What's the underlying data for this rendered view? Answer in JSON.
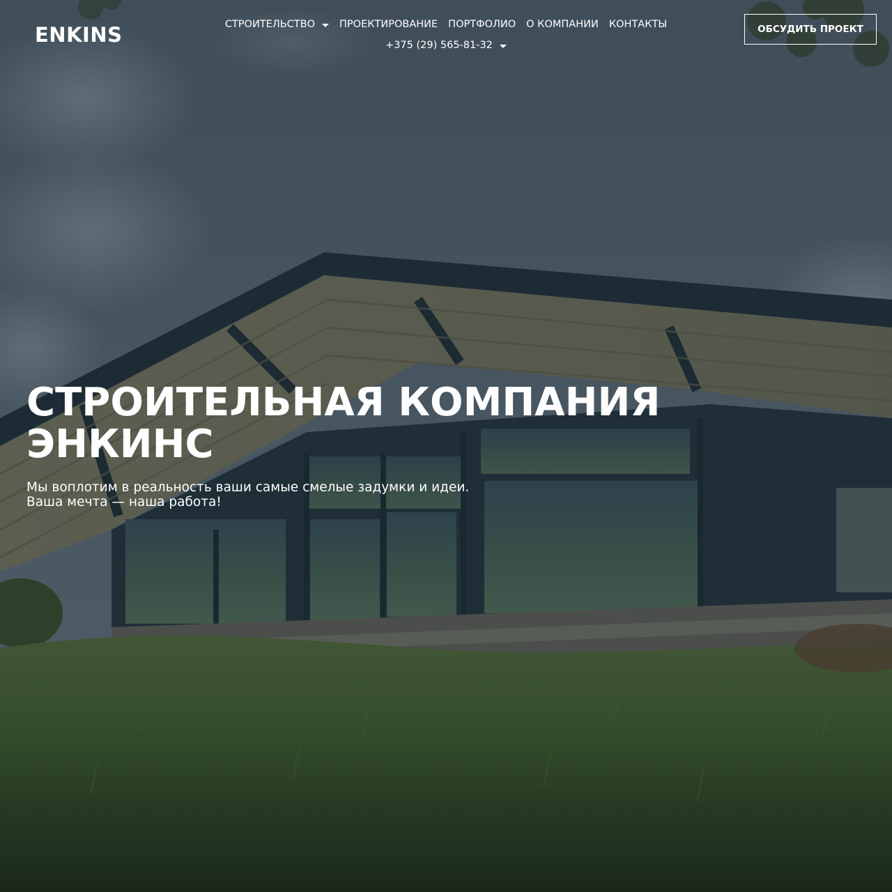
{
  "header": {
    "logo_text": "ENKINS",
    "nav_items": [
      {
        "label": "СТРОИТЕЛЬСТВО",
        "has_dropdown": true
      },
      {
        "label": "ПРОЕКТИРОВАНИЕ",
        "has_dropdown": false
      },
      {
        "label": "ПОРТФОЛИО",
        "has_dropdown": false
      },
      {
        "label": "О КОМПАНИИ",
        "has_dropdown": false
      },
      {
        "label": "КОНТАКТЫ",
        "has_dropdown": false
      }
    ],
    "phone": {
      "label": "+375 (29) 565-81-32",
      "has_dropdown": true
    },
    "cta_label": "ОБСУДИТЬ ПРОЕКТ"
  },
  "hero": {
    "title_line_1": "СТРОИТЕЛЬНАЯ КОМПАНИЯ",
    "title_line_2": "ЭНКИНС",
    "subtitle_line_1": "Мы воплотим в реальность ваши самые смелые задумки и идеи.",
    "subtitle_line_2": "Ваша мечта — наша работа!",
    "background_image": "modern-house-on-grassy-hill-photo"
  },
  "colors": {
    "text": "#ffffff",
    "overlay": "#1a2530",
    "sky": "#6b7d8c",
    "grass": "#3f5a26"
  }
}
